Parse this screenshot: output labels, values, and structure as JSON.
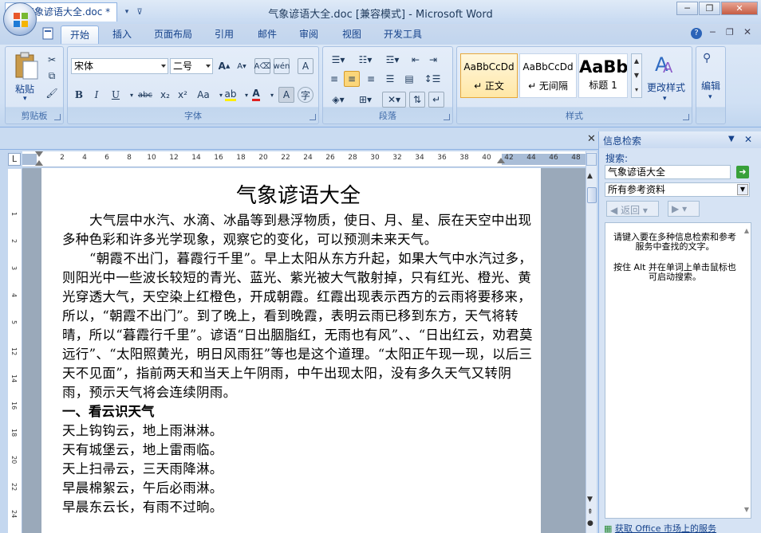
{
  "window": {
    "title": "气象谚语大全.doc [兼容模式] - Microsoft Word",
    "minimize": "─",
    "restore": "❐",
    "close": "✕"
  },
  "qat": {
    "save_icon": "save-icon",
    "undo_icon": "undo-icon",
    "redo_icon": "redo-icon",
    "print_preview_icon": "print-preview-icon",
    "customize_icon": "customize-icon"
  },
  "tabs": [
    "开始",
    "插入",
    "页面布局",
    "引用",
    "邮件",
    "审阅",
    "视图",
    "开发工具"
  ],
  "active_tab": 0,
  "ribbon": {
    "clipboard": {
      "label": "剪贴板",
      "paste": "粘贴"
    },
    "font": {
      "label": "字体",
      "font_name": "宋体",
      "font_size": "二号",
      "bold": "B",
      "italic": "I",
      "underline": "U",
      "strike": "abc",
      "sub": "x₂",
      "sup": "x²",
      "case": "Aa"
    },
    "paragraph": {
      "label": "段落"
    },
    "styles": {
      "label": "样式",
      "items": [
        {
          "sample": "AaBbCcDd",
          "name": "↵ 正文"
        },
        {
          "sample": "AaBbCcDd",
          "name": "↵ 无间隔"
        },
        {
          "sample": "AaBb",
          "name": "标题 1"
        }
      ],
      "change_styles": "更改样式"
    },
    "editing": {
      "label": "编辑"
    }
  },
  "doc_tab": {
    "label": "气象谚语大全.doc *"
  },
  "ruler_numbers": [
    "2",
    "4",
    "6",
    "8",
    "10",
    "12",
    "14",
    "16",
    "18",
    "20",
    "22",
    "24",
    "26",
    "28",
    "30",
    "32",
    "34",
    "36",
    "38",
    "40",
    "42",
    "44",
    "46",
    "48"
  ],
  "document": {
    "title": "气象谚语大全",
    "paragraphs": [
      "大气层中水汽、水滴、冰晶等到悬浮物质，使日、月、星、辰在天空中出现多种色彩和许多光学现象，观察它的变化，可以预测未来天气。",
      "“朝霞不出门，暮霞行千里”。早上太阳从东方升起，如果大气中水汽过多，则阳光中一些波长较短的青光、蓝光、紫光被大气散射掉，只有红光、橙光、黄光穿透大气，天空染上红橙色，开成朝霞。红霞出现表示西方的云雨将要移来，所以，“朝霞不出门”。到了晚上，看到晚霞，表明云雨已移到东方，天气将转晴，所以“暮霞行千里”。谚语“日出胭脂红，无雨也有风”、、“日出红云，劝君莫远行”、“太阳照黄光，明日风雨狂”等也是这个道理。“太阳正午现一现，以后三天不见面”，指前两天和当天上午阴雨，中午出现太阳，没有多久天气又转阴雨，预示天气将会连续阴雨。"
    ],
    "heading1": "一、看云识天气",
    "lines": [
      "天上钩钩云，地上雨淋淋。",
      "天有城堡云，地上雷雨临。",
      "天上扫帚云，三天雨降淋。",
      "早晨棉絮云，午后必雨淋。",
      "早晨东云长，有雨不过晌。"
    ]
  },
  "pane": {
    "title": "信息检索",
    "search_label": "搜索:",
    "search_value": "气象谚语大全",
    "source": "所有参考资料",
    "back": "返回",
    "hint1": "请键入要在多种信息检索和参考服务中查找的文字。",
    "hint2": "按住 Alt 并在单词上单击鼠标也可启动搜索。",
    "footer": "获取 Office 市场上的服务"
  }
}
